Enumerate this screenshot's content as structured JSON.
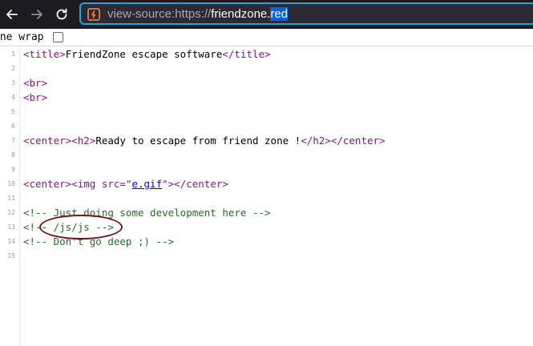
{
  "toolbar": {
    "back_icon": "back-arrow-icon",
    "forward_icon": "forward-arrow-icon",
    "reload_icon": "reload-icon",
    "url_prefix": "view-source:https://",
    "url_host": "friendzone.",
    "url_tld": "red"
  },
  "options": {
    "wrap_label": "ine wrap",
    "wrap_checked": false
  },
  "line_numbers": [
    "1",
    "2",
    "3",
    "4",
    "5",
    "6",
    "7",
    "8",
    "9",
    "10",
    "11",
    "12",
    "13",
    "14",
    "15"
  ],
  "source": {
    "l1": {
      "open": "<title>",
      "text": "FriendZone escape software",
      "close": "</title>"
    },
    "l3": "<br>",
    "l4": "<br>",
    "l7": {
      "open": "<center><h2>",
      "text": "Ready to escape from friend zone !",
      "close": "</h2></center>"
    },
    "l10": {
      "open": "<center><img ",
      "attr": "src",
      "eq": "=\"",
      "link": "e.gif",
      "end": "\"></center>"
    },
    "l12": "<!-- Just doing some development here -->",
    "l13": "<!-- /js/js -->",
    "l14": "<!-- Don't go deep ;) -->"
  },
  "colors": {
    "tag": "#881280",
    "attr_value": "#1a1aa6",
    "comment": "#236e25",
    "highlight_circle": "#7a1515"
  }
}
